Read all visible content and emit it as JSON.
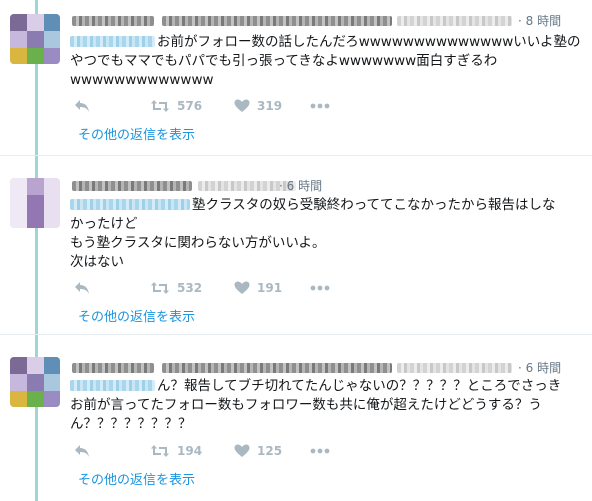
{
  "colors": {
    "accent": "#1b95e0",
    "thread_line": "#9ed6d8",
    "muted": "#657786",
    "icon": "#aab8c2"
  },
  "icons": {
    "reply": "reply-arrow-icon",
    "retweet": "retweet-icon",
    "like": "heart-icon",
    "more": "more-dots-icon"
  },
  "tweets": [
    {
      "time": "· 8 時間",
      "text": "お前がフォロー数の話したんだろwwwwwwwwwwwwwwいいよ塾の\nやつでもママでもパパでも引っ張ってきなよwwwwwww面白すぎるわ\nwwwwwwwwwwwww",
      "retweets": "576",
      "likes": "319",
      "more_replies": "その他の返信を表示"
    },
    {
      "time": "· 6 時間",
      "text": "塾クラスタの奴ら受験終わっててこなかったから報告はしな\nかったけど\nもう塾クラスタに関わらない方がいいよ。\n次はない",
      "retweets": "532",
      "likes": "191",
      "more_replies": "その他の返信を表示"
    },
    {
      "time": "· 6 時間",
      "text": "ん？報告してブチ切れてたんじゃないの？？？？？ところでさっき\nお前が言ってたフォロー数もフォロワー数も共に俺が超えたけどどうする？う\nん？？？？？？？？",
      "retweets": "194",
      "likes": "125",
      "more_replies": "その他の返信を表示"
    }
  ]
}
